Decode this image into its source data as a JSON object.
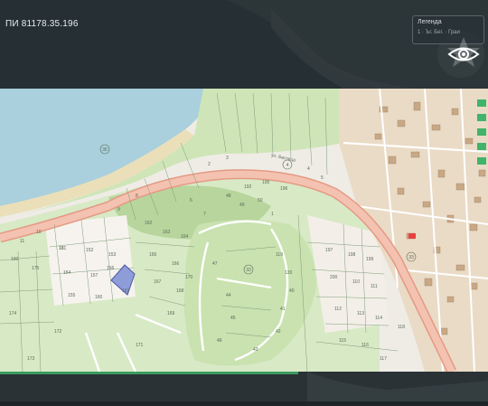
{
  "header": {
    "parcel_id": "ПИ 81178.35.196"
  },
  "legend": {
    "title": "Легенда",
    "row": "1 · Ъг. Бег. · Граи"
  },
  "map": {
    "zone_labels": [
      "35",
      "4",
      "33",
      "33"
    ],
    "road_label": "ул. Беглица",
    "plot_labels": [
      "151",
      "152",
      "153",
      "154",
      "157",
      "156",
      "155",
      "160",
      "161",
      "162",
      "163",
      "164",
      "165",
      "166",
      "167",
      "168",
      "169",
      "170",
      "171",
      "172",
      "173",
      "174",
      "175",
      "190",
      "192",
      "195",
      "196",
      "197",
      "198",
      "199",
      "200",
      "110",
      "111",
      "112",
      "113",
      "114",
      "115",
      "116",
      "117",
      "118",
      "119",
      "120",
      "40",
      "41",
      "42",
      "43",
      "44",
      "45",
      "46",
      "47",
      "48",
      "49",
      "50",
      "1",
      "2",
      "3",
      "4",
      "5",
      "6",
      "7",
      "8",
      "9",
      "10",
      "11",
      "12"
    ],
    "colors": {
      "water": "#a9d0dc",
      "road": "#f0b4a2",
      "green": "#c3dfa8",
      "urban": "#b89a7a",
      "selected": "#8e9cd8"
    }
  },
  "overlay": {
    "settings_icon": "eye-icon"
  }
}
